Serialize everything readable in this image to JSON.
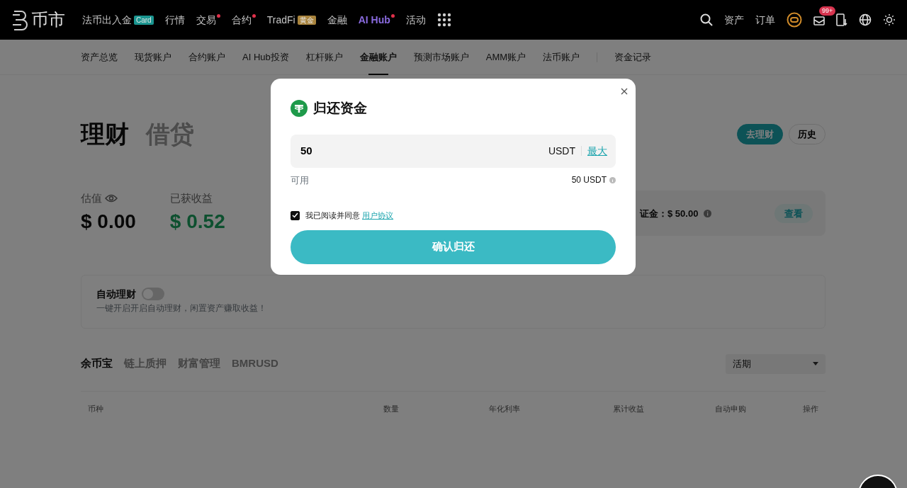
{
  "logo": {
    "text": "币市"
  },
  "nav": [
    {
      "label": "法币出入金",
      "tag": {
        "text": "Card",
        "color": "#1a9590"
      },
      "dot": false,
      "highlight": false
    },
    {
      "label": "行情",
      "dot": false,
      "highlight": false
    },
    {
      "label": "交易",
      "dot": true,
      "highlight": false
    },
    {
      "label": "合约",
      "dot": true,
      "highlight": false
    },
    {
      "label": "TradFi",
      "tag": {
        "text": "黄金",
        "color": "#a8833c"
      },
      "dot": false,
      "highlight": false
    },
    {
      "label": "金融",
      "dot": false,
      "highlight": false
    },
    {
      "label": "AI Hub",
      "dot": true,
      "highlight": true
    },
    {
      "label": "活动",
      "dot": false,
      "highlight": false
    }
  ],
  "nav_right": {
    "links": [
      "资产",
      "订单"
    ],
    "mail_badge": "99+"
  },
  "subnav": [
    {
      "label": "资产总览",
      "selected": false
    },
    {
      "label": "现货账户",
      "selected": false
    },
    {
      "label": "合约账户",
      "selected": false
    },
    {
      "label": "AI Hub投资",
      "selected": false
    },
    {
      "label": "杠杆账户",
      "selected": false
    },
    {
      "label": "金融账户",
      "selected": true
    },
    {
      "label": "预测市场账户",
      "selected": false
    },
    {
      "label": "AMM账户",
      "selected": false
    },
    {
      "label": "法币账户",
      "selected": false
    },
    {
      "label": "资金记录",
      "selected": false
    }
  ],
  "page_tabs": [
    {
      "label": "理财",
      "selected": true
    },
    {
      "label": "借贷",
      "selected": false
    }
  ],
  "header_buttons": [
    {
      "label": "去理财",
      "kind": "primary"
    },
    {
      "label": "历史",
      "kind": "outline"
    }
  ],
  "stats": [
    {
      "label": "估值",
      "value": "$ 0.00",
      "kind": "plain"
    },
    {
      "label": "已获收益",
      "value": "$ 0.52",
      "kind": "gain"
    }
  ],
  "margin_card": {
    "text": "证金：$ 50.00",
    "button": "查看"
  },
  "auto_invest": {
    "title": "自动理财",
    "on": false,
    "description": "一键开启开启自动理财，闲置资产赚取收益！"
  },
  "product_tabs": [
    {
      "label": "余币宝",
      "selected": true
    },
    {
      "label": "链上质押",
      "selected": false
    },
    {
      "label": "财富管理",
      "selected": false
    },
    {
      "label": "BMRUSD",
      "selected": false
    }
  ],
  "term_select": {
    "value": "活期"
  },
  "table": {
    "columns": [
      "币种",
      "数量",
      "年化利率",
      "累计收益",
      "自动申购",
      "操作"
    ]
  },
  "modal": {
    "title": "归还资金",
    "amount": "50",
    "currency": "USDT",
    "max": "最大",
    "available_label": "可用",
    "available_value": "50 USDT",
    "agree_text": "我已阅读并同意",
    "agree_link": "用户协议",
    "agreed": true,
    "confirm": "确认归还"
  }
}
